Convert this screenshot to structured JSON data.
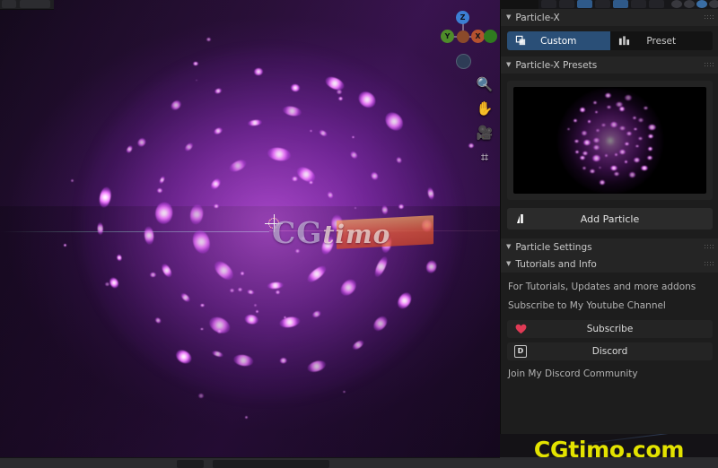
{
  "app": {
    "viewport_label": "3d-viewport"
  },
  "topbar": {
    "left_pill_labels": [
      "",
      ""
    ],
    "shading_modes": [
      "wireframe",
      "solid",
      "material-preview",
      "rendered"
    ]
  },
  "gizmo": {
    "axes": [
      {
        "label": "Z",
        "color": "#3c7fd4"
      },
      {
        "label": "X",
        "color": "#b5522f"
      },
      {
        "label": "Y",
        "color": "#4e8c2a"
      }
    ]
  },
  "viewport_tools": [
    {
      "name": "zoom-tool",
      "glyph": "🔍"
    },
    {
      "name": "pan-tool",
      "glyph": "✋"
    },
    {
      "name": "camera-tool",
      "glyph": "🎥"
    },
    {
      "name": "grid-tool",
      "glyph": "⌗"
    }
  ],
  "watermark": {
    "viewport_text_cg": "CG",
    "viewport_text_timo": "timo",
    "footer_text": "CGtimo.com",
    "footer_color": "#e3e300"
  },
  "panel": {
    "header": {
      "title": "Particle-X",
      "collapse_glyph": "▼"
    },
    "tabs": [
      {
        "label": "Custom",
        "icon": "copy-icon",
        "active": true
      },
      {
        "label": "Preset",
        "icon": "chart-icon",
        "active": false
      }
    ],
    "presets_section": {
      "title": "Particle-X Presets",
      "collapse_glyph": "▼",
      "preview_alt": "particle-preview-thumbnail",
      "add_button": {
        "label": "Add Particle",
        "icon": "particle-icon"
      }
    },
    "particle_settings_section": {
      "title": "Particle Settings",
      "collapse_glyph": "▼"
    },
    "tutorials_section": {
      "title": "Tutorials and Info",
      "collapse_glyph": "▼",
      "line_1": "For Tutorials, Updates and more addons",
      "line_2": "Subscribe to My Youtube Channel",
      "subscribe_button": {
        "label": "Subscribe",
        "icon": "heart-icon",
        "icon_color": "#e03a55"
      },
      "discord_button": {
        "label": "Discord",
        "icon": "discord-d-icon",
        "letter": "D"
      },
      "line_3": "Join My Discord Community"
    }
  },
  "colors": {
    "panel_bg": "#1d1d1d",
    "section_header_bg": "#252525",
    "tab_active_bg": "#2a4f77",
    "button_bg": "#2b2b2b",
    "text_primary": "#dcdcdc",
    "text_muted": "#b2b2b2",
    "viewport_purple": "#8a2ecc"
  }
}
